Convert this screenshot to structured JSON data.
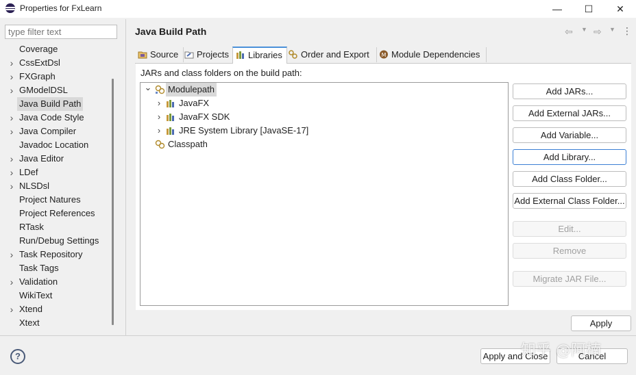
{
  "window": {
    "title": "Properties for FxLearn",
    "minimize": "—",
    "maximize": "☐",
    "close": "✕"
  },
  "filter": {
    "placeholder": "type filter text"
  },
  "nav": {
    "items": [
      {
        "label": "Coverage",
        "expandable": false
      },
      {
        "label": "CssExtDsl",
        "expandable": true
      },
      {
        "label": "FXGraph",
        "expandable": true
      },
      {
        "label": "GModelDSL",
        "expandable": true
      },
      {
        "label": "Java Build Path",
        "expandable": false,
        "selected": true
      },
      {
        "label": "Java Code Style",
        "expandable": true
      },
      {
        "label": "Java Compiler",
        "expandable": true
      },
      {
        "label": "Javadoc Location",
        "expandable": false
      },
      {
        "label": "Java Editor",
        "expandable": true
      },
      {
        "label": "LDef",
        "expandable": true
      },
      {
        "label": "NLSDsl",
        "expandable": true
      },
      {
        "label": "Project Natures",
        "expandable": false
      },
      {
        "label": "Project References",
        "expandable": false
      },
      {
        "label": "RTask",
        "expandable": false
      },
      {
        "label": "Run/Debug Settings",
        "expandable": false
      },
      {
        "label": "Task Repository",
        "expandable": true
      },
      {
        "label": "Task Tags",
        "expandable": false
      },
      {
        "label": "Validation",
        "expandable": true
      },
      {
        "label": "WikiText",
        "expandable": false
      },
      {
        "label": "Xtend",
        "expandable": true
      },
      {
        "label": "Xtext",
        "expandable": false
      }
    ]
  },
  "page": {
    "title": "Java Build Path"
  },
  "tabs": [
    {
      "label": "Source",
      "icon": "source-folder-icon"
    },
    {
      "label": "Projects",
      "icon": "projects-icon"
    },
    {
      "label": "Libraries",
      "icon": "libraries-icon",
      "active": true
    },
    {
      "label": "Order and Export",
      "icon": "order-export-icon"
    },
    {
      "label": "Module Dependencies",
      "icon": "module-dependencies-icon"
    }
  ],
  "libraries": {
    "heading": "JARs and class folders on the build path:",
    "tree": [
      {
        "label": "Modulepath",
        "icon": "modulepath-icon",
        "chevron": "⌄",
        "selected": true
      },
      {
        "label": "JavaFX",
        "icon": "library-icon",
        "chevron": "›"
      },
      {
        "label": "JavaFX SDK",
        "icon": "library-icon",
        "chevron": "›"
      },
      {
        "label": "JRE System Library [JavaSE-17]",
        "icon": "library-icon",
        "chevron": "›"
      },
      {
        "label": "Classpath",
        "icon": "classpath-icon",
        "chevron": ""
      }
    ],
    "buttons": {
      "add_jars": "Add JARs...",
      "add_external_jars": "Add External JARs...",
      "add_variable": "Add Variable...",
      "add_library": "Add Library...",
      "add_class_folder": "Add Class Folder...",
      "add_external_class_folder": "Add External Class Folder...",
      "edit": "Edit...",
      "remove": "Remove",
      "migrate_jar": "Migrate JAR File..."
    }
  },
  "apply": "Apply",
  "footer": {
    "help": "?",
    "apply_and_close": "Apply and Close",
    "cancel": "Cancel"
  },
  "watermark": "知乎 @阿楠"
}
